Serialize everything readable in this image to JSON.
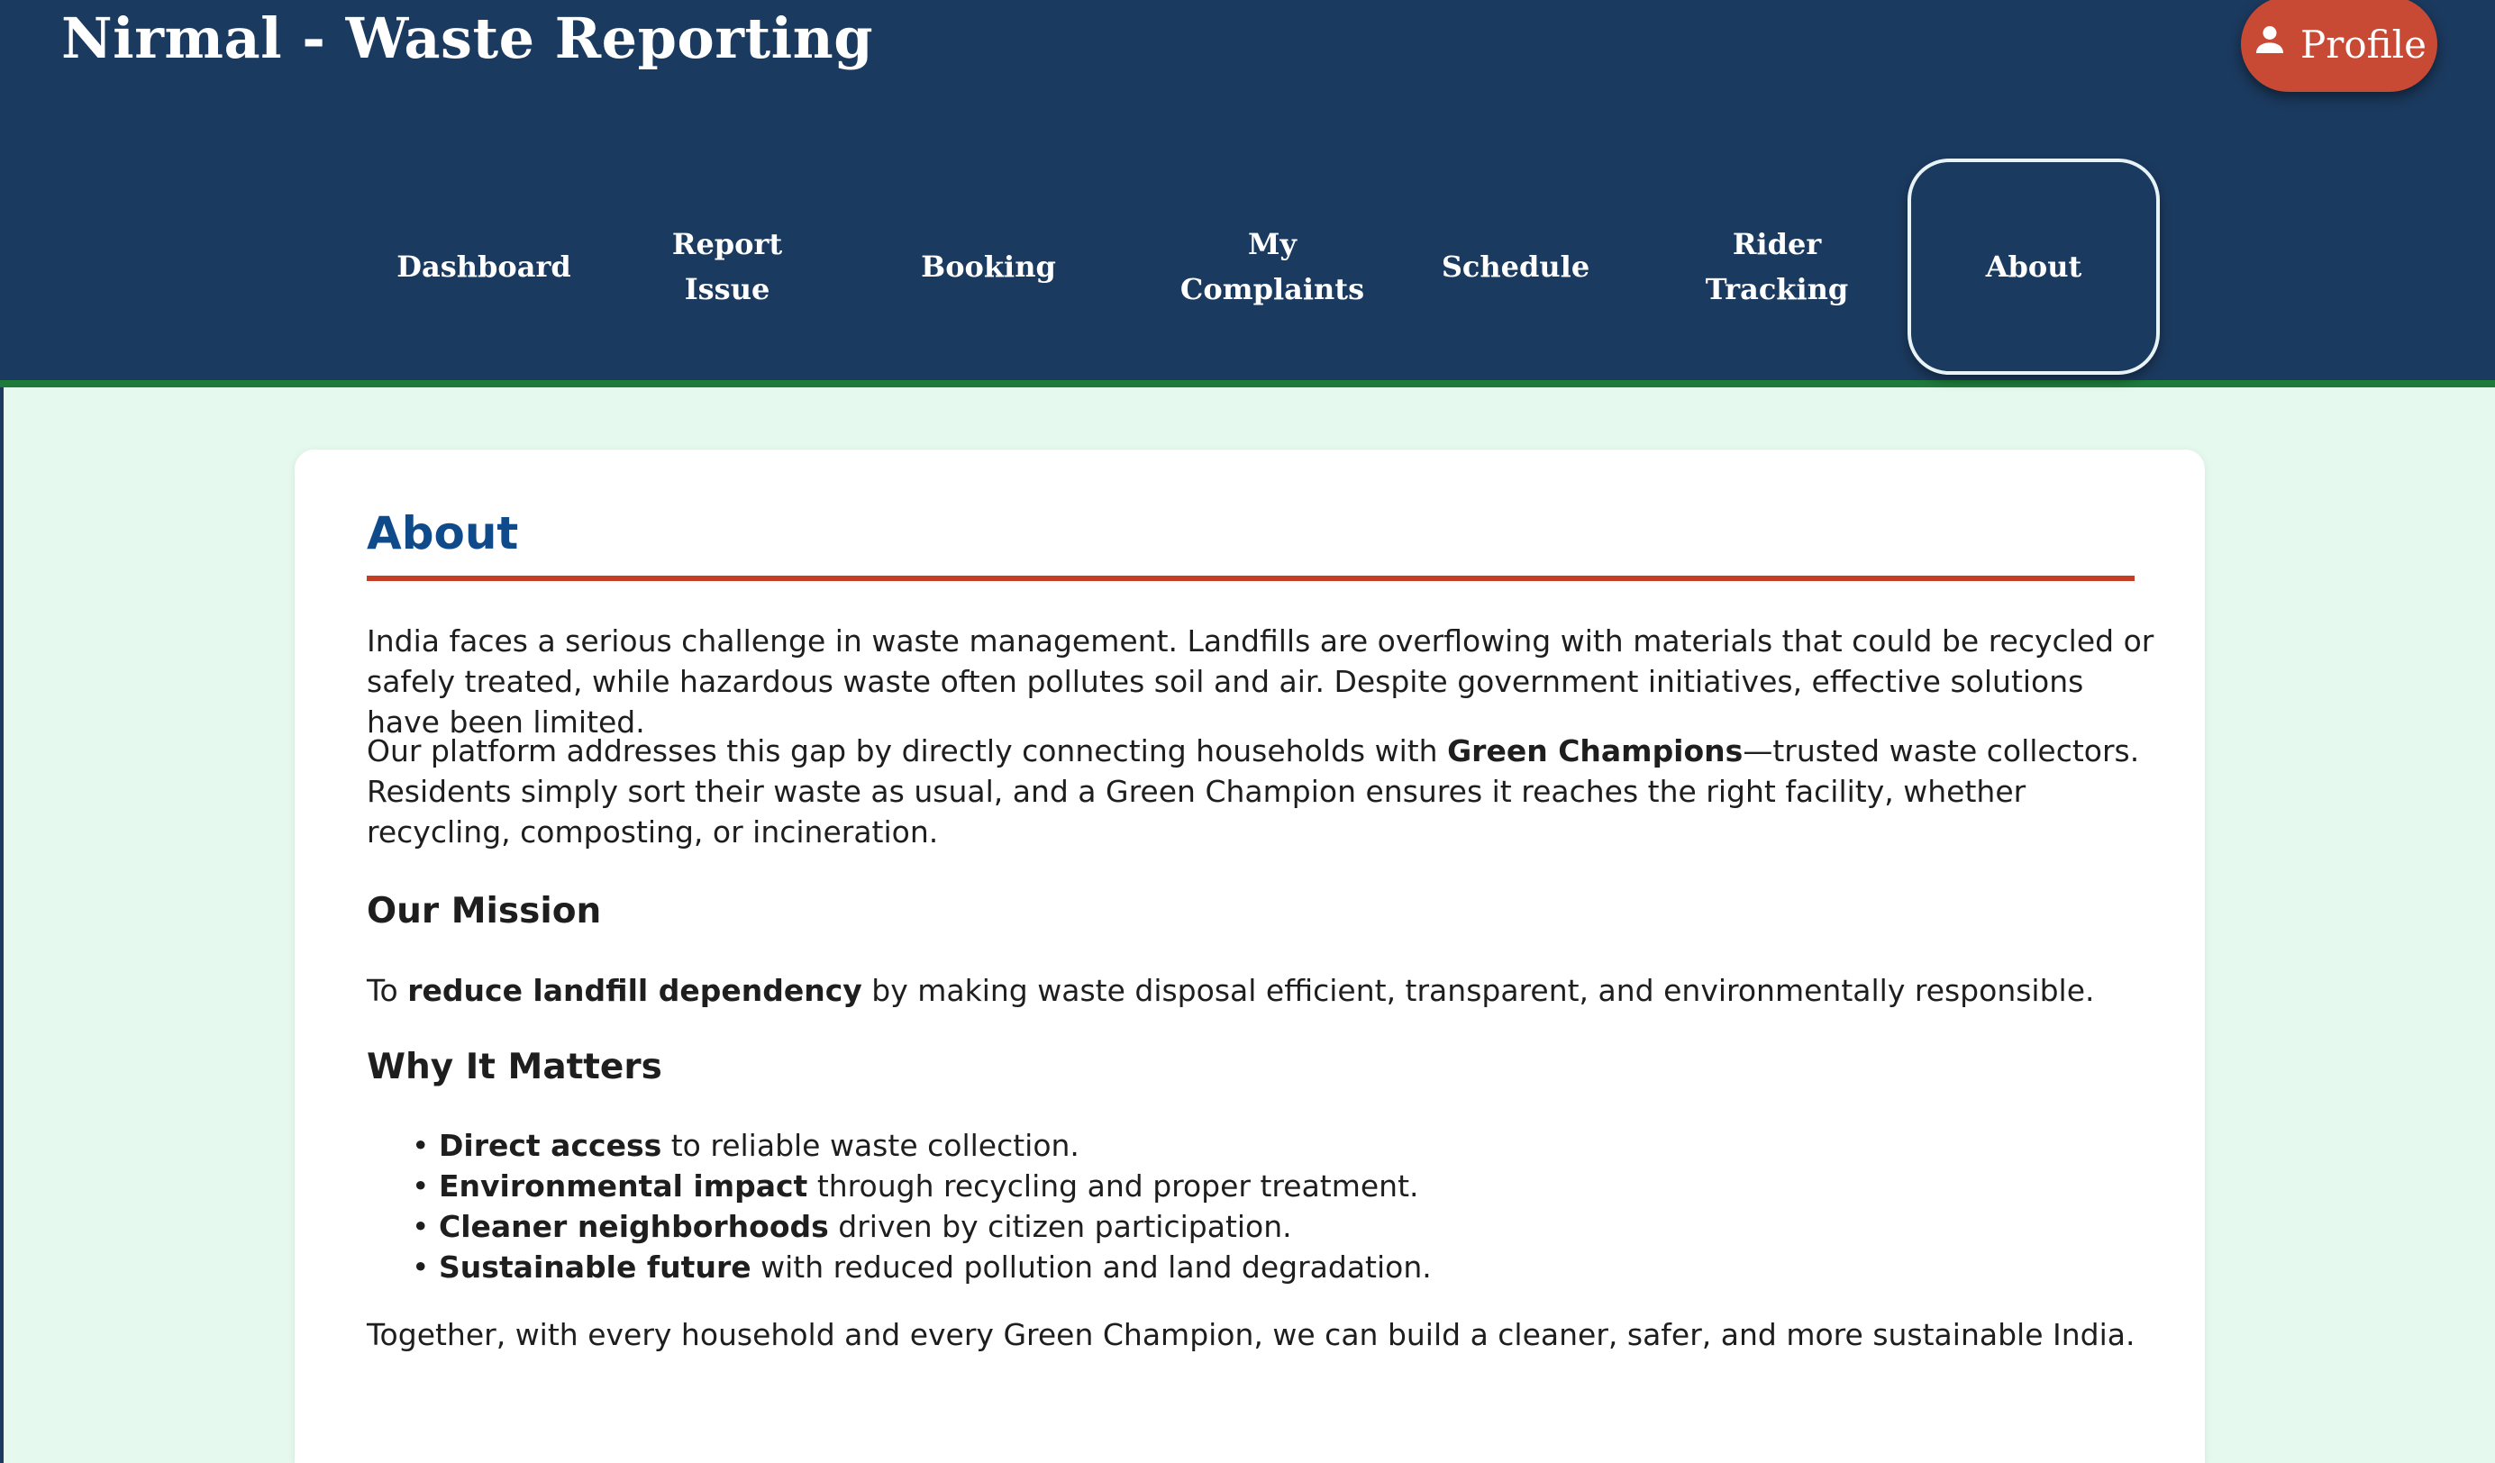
{
  "header": {
    "app_title": "Nirmal - Waste Reporting",
    "profile_label": "Profile",
    "profile_icon": "person-icon"
  },
  "nav": [
    {
      "label": "Dashboard",
      "active": false
    },
    {
      "label": "Report Issue",
      "active": false
    },
    {
      "label": "Booking",
      "active": false
    },
    {
      "label": "My Complaints",
      "active": false
    },
    {
      "label": "Schedule",
      "active": false
    },
    {
      "label": "Rider Tracking",
      "active": false
    },
    {
      "label": "About",
      "active": true
    }
  ],
  "about": {
    "title": "About",
    "p1": "India faces a serious challenge in waste management. Landfills are overflowing with materials that could be recycled or safely treated, while hazardous waste often pollutes soil and air. Despite government initiatives, effective solutions have been limited.",
    "p2_pre": "Our platform addresses this gap by directly connecting households with ",
    "p2_bold": "Green Champions",
    "p2_post": "—trusted waste collectors. Residents simply sort their waste as usual, and a Green Champion ensures it reaches the right facility, whether recycling, composting, or incineration.",
    "mission_heading": "Our Mission",
    "mission_pre": "To ",
    "mission_bold": "reduce landfill dependency",
    "mission_post": " by making waste disposal efficient, transparent, and environmentally responsible.",
    "why_heading": "Why It Matters",
    "why_items": [
      {
        "bold": "Direct access",
        "text": " to reliable waste collection."
      },
      {
        "bold": "Environmental impact",
        "text": " through recycling and proper treatment."
      },
      {
        "bold": "Cleaner neighborhoods",
        "text": " driven by citizen participation."
      },
      {
        "bold": "Sustainable future",
        "text": " with reduced pollution and land degradation."
      }
    ],
    "closing": "Together, with every household and every Green Champion, we can build a cleaner, safer, and more sustainable India."
  },
  "colors": {
    "header_bg": "#1b3a5f",
    "header_border": "#1e7a3a",
    "profile_bg": "#c94a34",
    "page_bg": "#e6f9ee",
    "title_color": "#0f4a8a",
    "title_rule": "#c43d24"
  }
}
